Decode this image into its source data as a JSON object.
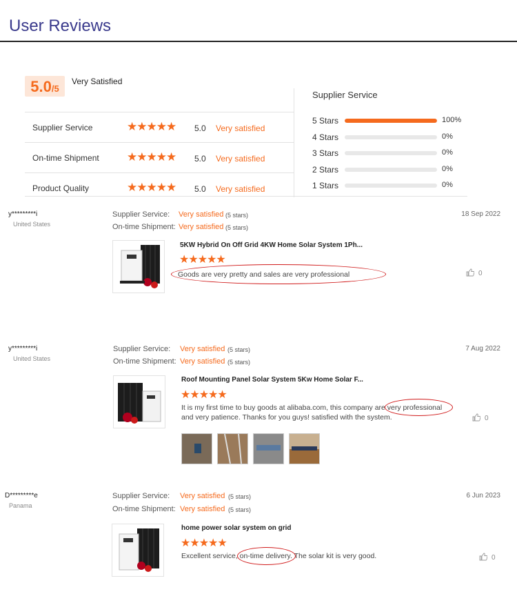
{
  "page": {
    "title": "User Reviews"
  },
  "summary": {
    "score": "5.0",
    "score_max": "/5",
    "overall_label": "Very Satisfied",
    "ratings": [
      {
        "label": "Supplier Service",
        "stars": "★★★★★",
        "score": "5.0",
        "text": "Very satisfied"
      },
      {
        "label": "On-time Shipment",
        "stars": "★★★★★",
        "score": "5.0",
        "text": "Very satisfied"
      },
      {
        "label": "Product Quality",
        "stars": "★★★★★",
        "score": "5.0",
        "text": "Very satisfied"
      }
    ]
  },
  "distribution": {
    "title": "Supplier Service",
    "rows": [
      {
        "label": "5 Stars",
        "percent": "100%",
        "fill": 1.0
      },
      {
        "label": "4 Stars",
        "percent": "0%",
        "fill": 0
      },
      {
        "label": "3 Stars",
        "percent": "0%",
        "fill": 0
      },
      {
        "label": "2 Stars",
        "percent": "0%",
        "fill": 0
      },
      {
        "label": "1 Stars",
        "percent": "0%",
        "fill": 0
      }
    ]
  },
  "reviews": [
    {
      "user": "y*********i",
      "country": "United States",
      "date": "18 Sep 2022",
      "supplier_label": "Supplier Service:",
      "supplier_value": "Very satisfied",
      "supplier_note": "(5 stars)",
      "shipment_label": "On-time Shipment:",
      "shipment_value": "Very satisfied",
      "shipment_note": "(5 stars)",
      "product": "5KW Hybrid On Off Grid 4KW Home Solar System 1Ph...",
      "stars": "★★★★★",
      "text": "Goods are very pretty and sales are very professional",
      "likes": "0"
    },
    {
      "user": "y*********i",
      "country": "United States",
      "date": "7 Aug 2022",
      "supplier_label": "Supplier Service:",
      "supplier_value": "Very satisfied",
      "supplier_note": "(5 stars)",
      "shipment_label": "On-time Shipment:",
      "shipment_value": "Very satisfied",
      "shipment_note": "(5 stars)",
      "product": "Roof Mounting Panel Solar System 5Kw Home Solar F...",
      "stars": "★★★★★",
      "text_line1": "It is my first time to buy goods at alibaba.com, this company are very professional",
      "text_line2": "and very patience. Thanks for you guys! satisfied with the system.",
      "likes": "0"
    },
    {
      "user": "D*********e",
      "country": "Panama",
      "date": "6 Jun 2023",
      "supplier_label": "Supplier Service:",
      "supplier_value": "Very satisfied",
      "supplier_note": "(5 stars)",
      "shipment_label": "On-time Shipment:",
      "shipment_value": "Very satisfied",
      "shipment_note": "(5 stars)",
      "product": "home power solar system on grid",
      "stars": "★★★★★",
      "text": "Excellent service, on-time delivery. The solar kit is very good.",
      "likes": "0"
    }
  ],
  "colors": {
    "accent": "#f56a1d",
    "title": "#3a3a8c",
    "annotation": "#d01a1a"
  }
}
